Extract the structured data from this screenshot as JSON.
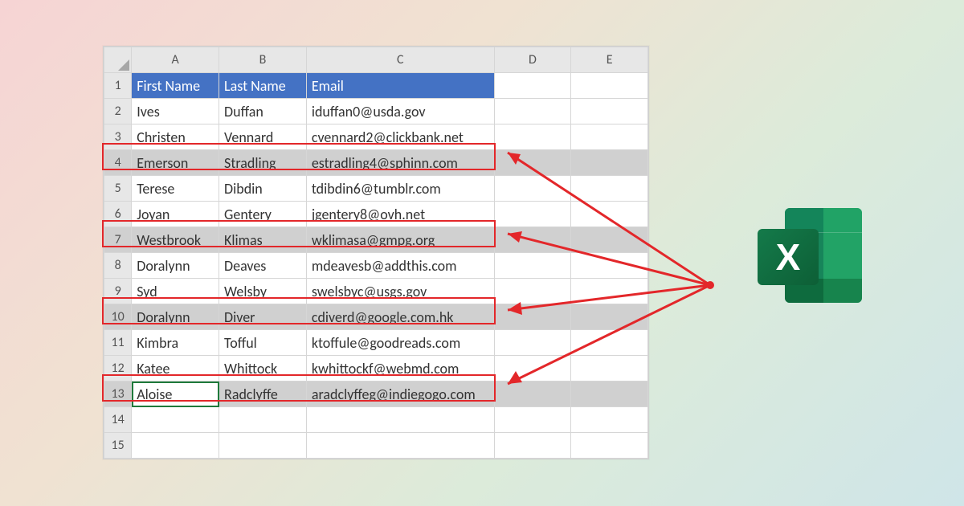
{
  "columns": {
    "A": "A",
    "B": "B",
    "C": "C",
    "D": "D",
    "E": "E"
  },
  "header": {
    "first_name": "First Name",
    "last_name": "Last Name",
    "email": "Email"
  },
  "rows": [
    {
      "n": "1"
    },
    {
      "n": "2",
      "a": "Ives",
      "b": "Duffan",
      "c": "iduffan0@usda.gov"
    },
    {
      "n": "3",
      "a": "Christen",
      "b": "Vennard",
      "c": "cvennard2@clickbank.net"
    },
    {
      "n": "4",
      "a": "Emerson",
      "b": "Stradling",
      "c": "estradling4@sphinn.com"
    },
    {
      "n": "5",
      "a": "Terese",
      "b": "Dibdin",
      "c": "tdibdin6@tumblr.com"
    },
    {
      "n": "6",
      "a": "Joyan",
      "b": "Gentery",
      "c": "jgentery8@ovh.net"
    },
    {
      "n": "7",
      "a": "Westbrook",
      "b": "Klimas",
      "c": "wklimasa@gmpg.org"
    },
    {
      "n": "8",
      "a": "Doralynn",
      "b": "Deaves",
      "c": "mdeavesb@addthis.com"
    },
    {
      "n": "9",
      "a": "Syd",
      "b": "Welsby",
      "c": "swelsbyc@usgs.gov"
    },
    {
      "n": "10",
      "a": "Doralynn",
      "b": "Diver",
      "c": "cdiverd@google.com.hk"
    },
    {
      "n": "11",
      "a": "Kimbra",
      "b": "Tofful",
      "c": "ktoffule@goodreads.com"
    },
    {
      "n": "12",
      "a": "Katee",
      "b": "Whittock",
      "c": "kwhittockf@webmd.com"
    },
    {
      "n": "13",
      "a": "Aloise",
      "b": "Radclyffe",
      "c": "aradclyffeg@indiegogo.com"
    },
    {
      "n": "14"
    },
    {
      "n": "15"
    }
  ],
  "selected_rows": [
    4,
    7,
    10,
    13
  ],
  "active_cell": "A13",
  "icon": {
    "label": "X"
  }
}
